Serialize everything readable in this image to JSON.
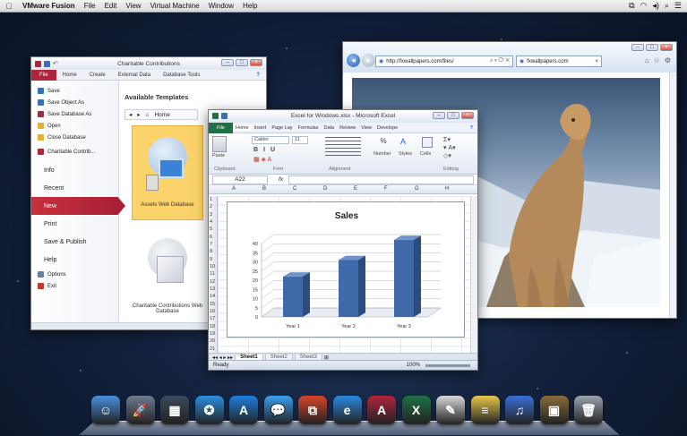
{
  "menubar": {
    "app": "VMware Fusion",
    "items": [
      "File",
      "Edit",
      "View",
      "Virtual Machine",
      "Window",
      "Help"
    ]
  },
  "access": {
    "title": "Charitable Contributions",
    "tabs": [
      "File",
      "Home",
      "Create",
      "External Data",
      "Database Tools"
    ],
    "menu": [
      {
        "label": "Save",
        "icon": "save-icon",
        "color": "#3b6fb6"
      },
      {
        "label": "Save Object As",
        "icon": "save-object-icon",
        "color": "#3b6fb6"
      },
      {
        "label": "Save Database As",
        "icon": "save-database-icon",
        "color": "#8a3548"
      },
      {
        "label": "Open",
        "icon": "folder-icon",
        "color": "#e2b23a"
      },
      {
        "label": "Close Database",
        "icon": "close-database-icon",
        "color": "#e2b23a"
      },
      {
        "label": "Charitable Contrib...",
        "icon": "database-icon",
        "color": "#a52a3a"
      }
    ],
    "sections": [
      "Info",
      "Recent",
      "New",
      "Print",
      "Save & Publish",
      "Help"
    ],
    "bottom": [
      {
        "label": "Options",
        "icon": "options-icon",
        "color": "#6a7f9b"
      },
      {
        "label": "Exit",
        "icon": "exit-icon",
        "color": "#c0392b"
      }
    ],
    "heading": "Available Templates",
    "nav_home": "Home",
    "templates": [
      {
        "label": "Assets Web Database"
      },
      {
        "label": "Charitable Contributions Web Database"
      }
    ]
  },
  "browser": {
    "address": "http://fxwallpapers.com/files/",
    "tab": "fxwallpapers.com"
  },
  "excel": {
    "title": "Excel for Windows.xlsx - Microsoft Excel",
    "tabs": [
      "File",
      "Home",
      "Insert",
      "Page Lay",
      "Formulas",
      "Data",
      "Review",
      "View",
      "Develope"
    ],
    "font": "Calibri",
    "size": "11",
    "groups": [
      "Clipboard",
      "Font",
      "Alignment",
      "Number",
      "Styles",
      "Cells",
      "Editing"
    ],
    "ribbon_labels": {
      "paste": "Paste",
      "number": "Number",
      "styles": "Styles",
      "cells": "Cells"
    },
    "namebox": "A22",
    "fx": "fx",
    "columns": [
      "A",
      "B",
      "C",
      "D",
      "E",
      "F",
      "G",
      "H"
    ],
    "rows": [
      "1",
      "2",
      "3",
      "4",
      "5",
      "6",
      "7",
      "8",
      "9",
      "10",
      "11",
      "12",
      "13",
      "14",
      "15",
      "16",
      "17",
      "18",
      "19",
      "20",
      "21"
    ],
    "sheets": [
      "Sheet1",
      "Sheet2",
      "Sheet3"
    ],
    "status": "Ready",
    "zoom": "100%"
  },
  "chart_data": {
    "type": "bar",
    "title": "Sales",
    "categories": [
      "Year 1",
      "Year 2",
      "Year 3"
    ],
    "values": [
      22,
      31,
      42
    ],
    "ylim": [
      0,
      40
    ],
    "yticks": [
      0,
      5,
      10,
      15,
      20,
      25,
      30,
      35,
      40
    ],
    "xlabel": "",
    "ylabel": "",
    "bar_color": "#3f69a8",
    "grid": true
  },
  "dock": [
    {
      "name": "finder-icon",
      "glyph": "☺",
      "color": "#4a8fe0"
    },
    {
      "name": "launchpad-icon",
      "glyph": "🚀",
      "color": "#6f7b8f"
    },
    {
      "name": "mission-control-icon",
      "glyph": "▦",
      "color": "#3b4a5e"
    },
    {
      "name": "safari-icon",
      "glyph": "✪",
      "color": "#2d8fe0"
    },
    {
      "name": "app-store-icon",
      "glyph": "A",
      "color": "#1d7ee0"
    },
    {
      "name": "messages-icon",
      "glyph": "💬",
      "color": "#3aa0f0"
    },
    {
      "name": "vmware-icon",
      "glyph": "⧉",
      "color": "#d8452a"
    },
    {
      "name": "internet-explorer-icon",
      "glyph": "e",
      "color": "#2a8ae0"
    },
    {
      "name": "access-icon",
      "glyph": "A",
      "color": "#b0243c"
    },
    {
      "name": "excel-icon",
      "glyph": "X",
      "color": "#1e7145"
    },
    {
      "name": "textedit-icon",
      "glyph": "✎",
      "color": "#d8d8d8"
    },
    {
      "name": "notes-icon",
      "glyph": "≡",
      "color": "#e8c84a"
    },
    {
      "name": "itunes-icon",
      "glyph": "♫",
      "color": "#3a6fd8"
    },
    {
      "name": "iphoto-icon",
      "glyph": "▣",
      "color": "#8a6a3a"
    },
    {
      "name": "trash-icon",
      "glyph": "🗑",
      "color": "#9aa3ae"
    }
  ]
}
